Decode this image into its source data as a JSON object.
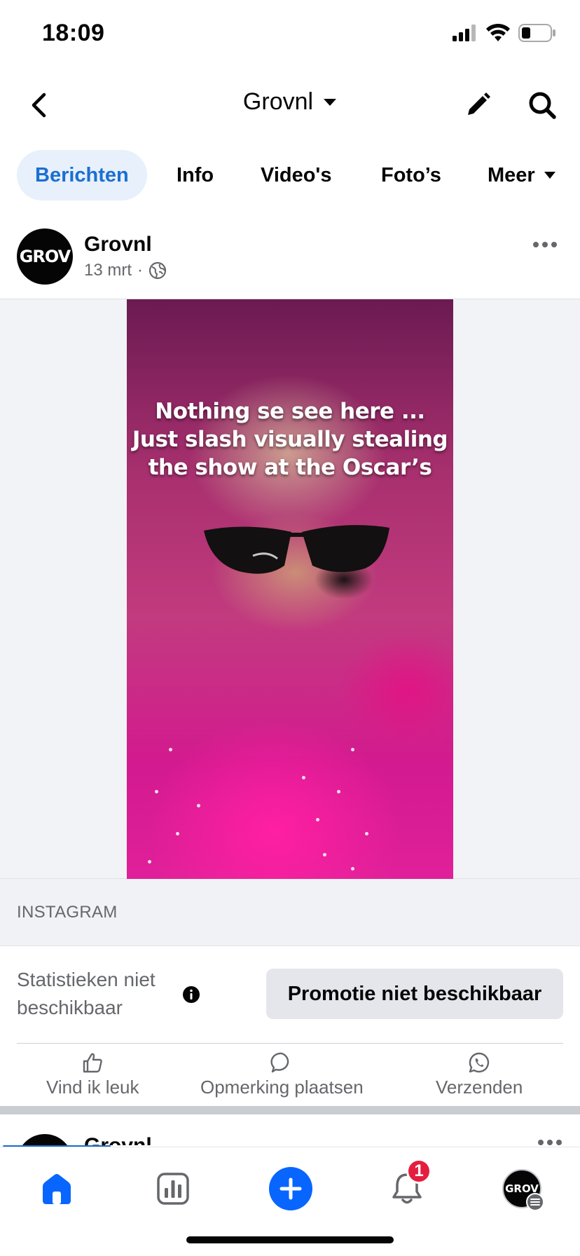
{
  "status_bar": {
    "time": "18:09"
  },
  "header": {
    "title": "Grovnl"
  },
  "tabs": [
    {
      "label": "Berichten",
      "active": true
    },
    {
      "label": "Info",
      "active": false
    },
    {
      "label": "Video's",
      "active": false
    },
    {
      "label": "Foto’s",
      "active": false
    },
    {
      "label": "Meer",
      "active": false
    }
  ],
  "post": {
    "avatar_text": "GROV",
    "author": "Grovnl",
    "date": "13 mrt",
    "separator": "·",
    "video_caption_lines": [
      "Nothing se see here ...",
      "Just slash visually stealing",
      "the show at the Oscar’s"
    ],
    "link_source": "INSTAGRAM",
    "stats_text": "Statistieken niet beschikbaar",
    "promo_label": "Promotie niet beschikbaar",
    "actions": {
      "like": "Vind ik leuk",
      "comment": "Opmerking plaatsen",
      "send": "Verzenden"
    }
  },
  "next_post": {
    "author": "Grovnl"
  },
  "bottom_nav": {
    "notifications_badge": "1",
    "profile_avatar_text": "GROV",
    "active": "home"
  },
  "colors": {
    "accent": "#1b6fd1",
    "create_button": "#0866ff",
    "badge": "#e41e3f",
    "tab_active_bg": "#e7f0fb"
  }
}
